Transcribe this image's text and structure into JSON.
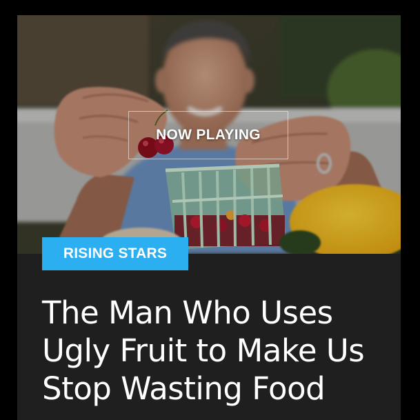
{
  "now_playing_label": "NOW PLAYING",
  "category_badge": "RISING STARS",
  "headline": "The Man Who Uses Ugly Fruit to Make Us Stop Wasting Food",
  "colors": {
    "page_background": "#000000",
    "card_background": "#1f1f1f",
    "badge_background": "#2baff0",
    "text": "#ffffff"
  }
}
